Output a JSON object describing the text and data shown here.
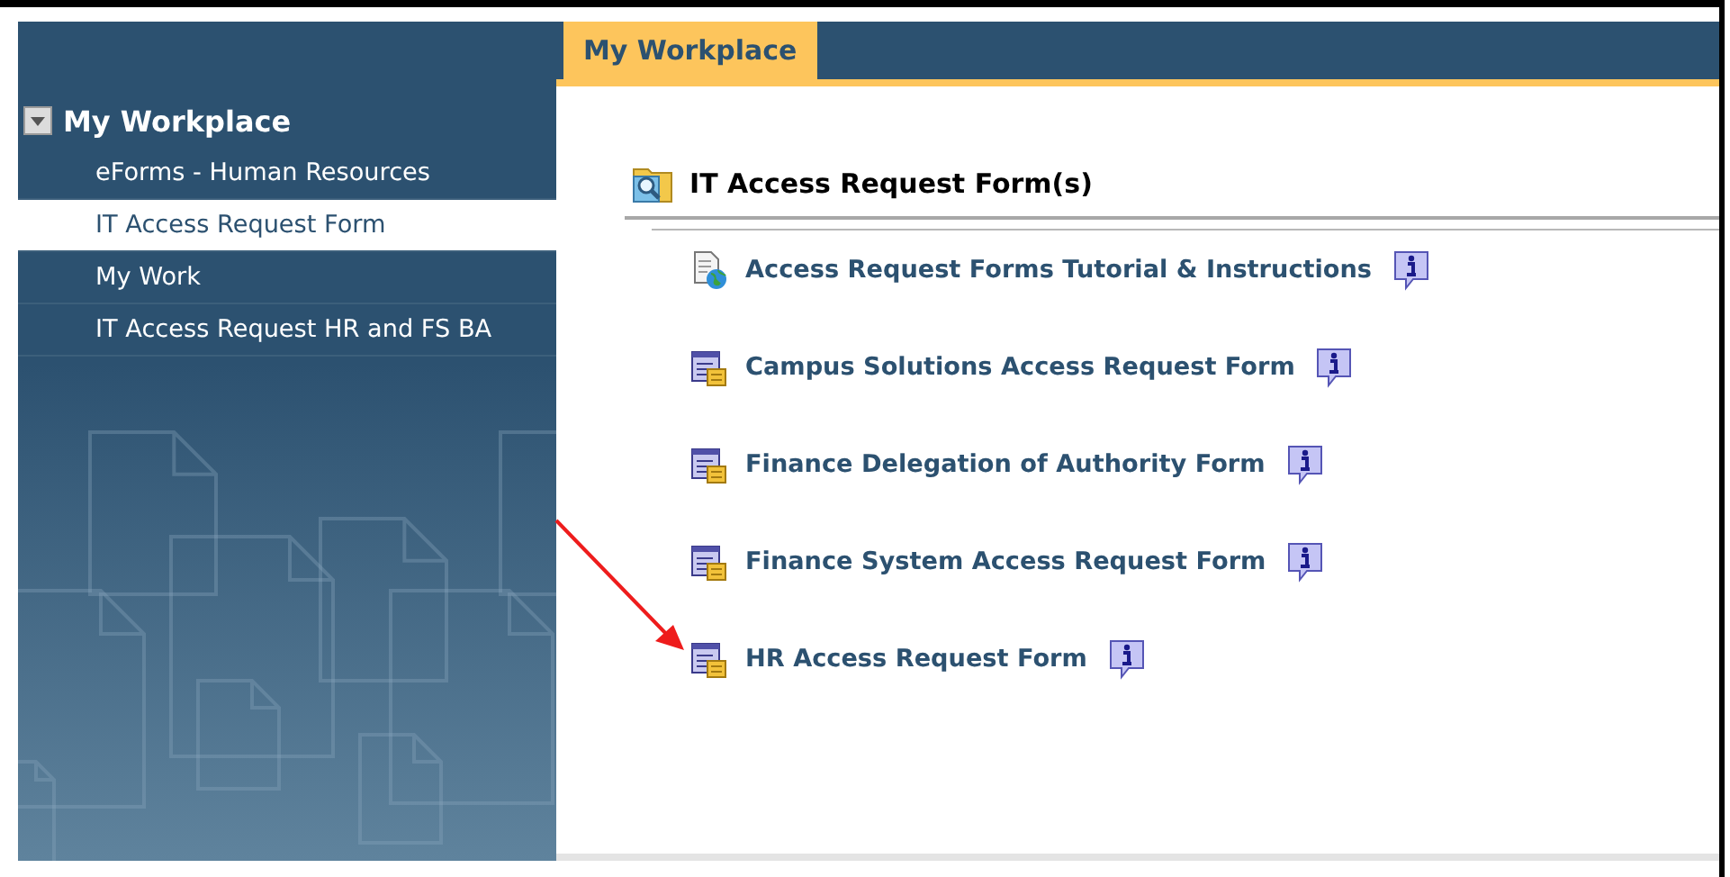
{
  "tab": {
    "label": "My Workplace",
    "selected": true
  },
  "sidebar": {
    "title": "My Workplace",
    "expanded": true,
    "items": [
      {
        "label": "eForms - Human Resources",
        "selected": false
      },
      {
        "label": "IT Access Request Form",
        "selected": true
      },
      {
        "label": "My Work",
        "selected": false
      },
      {
        "label": "IT Access Request HR and FS BA",
        "selected": false
      }
    ]
  },
  "section": {
    "title": "IT Access Request Form(s)",
    "links": [
      {
        "label": "Access Request Forms Tutorial & Instructions",
        "kind": "document"
      },
      {
        "label": "Campus Solutions Access Request Form",
        "kind": "form"
      },
      {
        "label": "Finance Delegation of Authority Form",
        "kind": "form"
      },
      {
        "label": "Finance System Access Request Form",
        "kind": "form"
      },
      {
        "label": "HR Access Request Form",
        "kind": "form"
      }
    ]
  }
}
